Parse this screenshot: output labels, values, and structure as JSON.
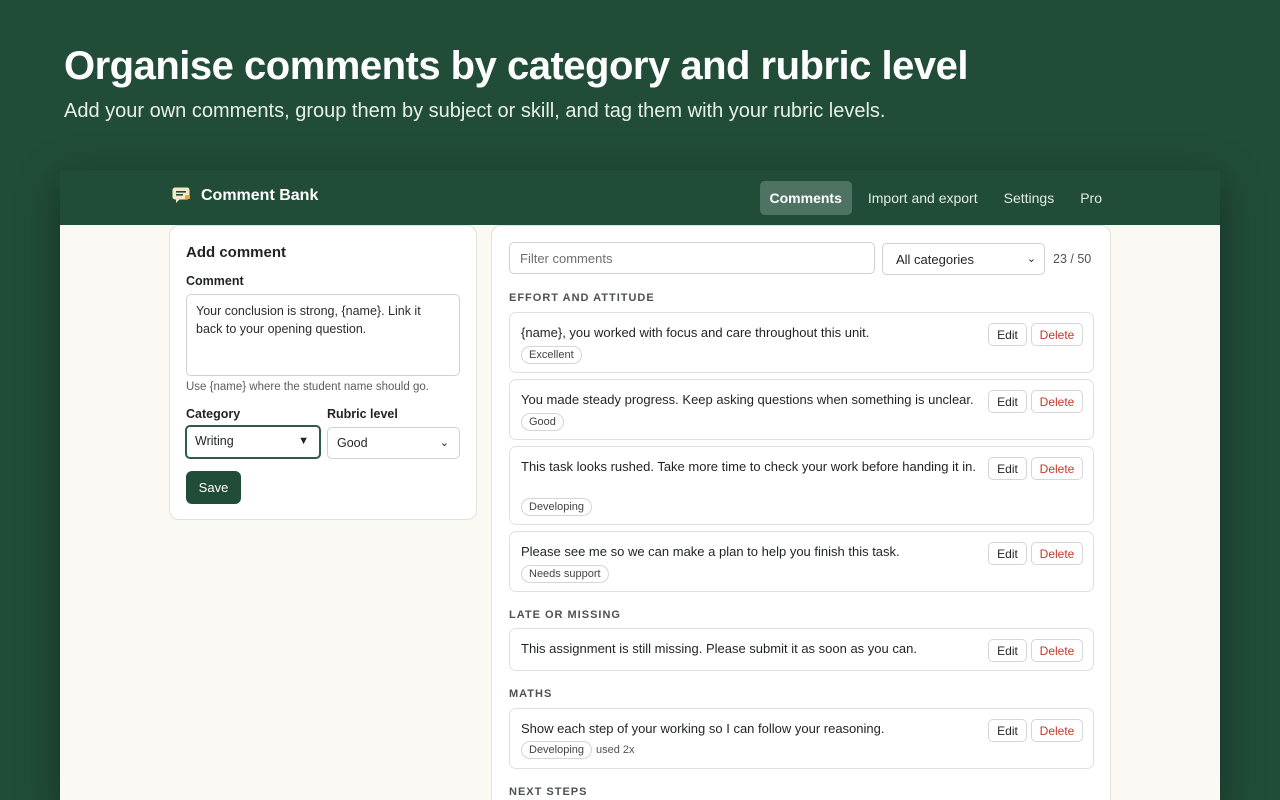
{
  "hero": {
    "title": "Organise comments by category and rubric level",
    "subtitle": "Add your own comments, group them by subject or skill, and tag them with your rubric levels."
  },
  "app": {
    "brand": "Comment Bank",
    "brand_icon": "speech-bubble-icon",
    "nav": [
      "Comments",
      "Import and export",
      "Settings",
      "Pro"
    ],
    "active_nav": "Comments"
  },
  "add_comment": {
    "title": "Add comment",
    "comment_label": "Comment",
    "comment_value": "Your conclusion is strong, {name}. Link it back to your opening question.",
    "hint": "Use {name} where the student name should go.",
    "category_label": "Category",
    "category_value": "Writing",
    "rubric_label": "Rubric level",
    "rubric_value": "Good",
    "save_label": "Save"
  },
  "list": {
    "filter_placeholder": "Filter comments",
    "category_filter": "All categories",
    "count": "23 / 50",
    "edit_label": "Edit",
    "delete_label": "Delete",
    "sections": [
      {
        "heading": "EFFORT AND ATTITUDE",
        "items": [
          {
            "text": "{name}, you worked with focus and care throughout this unit.",
            "tag": "Excellent"
          },
          {
            "text": "You made steady progress. Keep asking questions when something is unclear.",
            "tag": "Good"
          },
          {
            "text": "This task looks rushed. Take more time to check your work before handing it in.",
            "tag": "Developing"
          },
          {
            "text": "Please see me so we can make a plan to help you finish this task.",
            "tag": "Needs support"
          }
        ]
      },
      {
        "heading": "LATE OR MISSING",
        "items": [
          {
            "text": "This assignment is still missing. Please submit it as soon as you can."
          }
        ]
      },
      {
        "heading": "MATHS",
        "items": [
          {
            "text": "Show each step of your working so I can follow your reasoning.",
            "tag": "Developing",
            "usage": "used 2x"
          }
        ]
      },
      {
        "heading": "NEXT STEPS",
        "items": []
      }
    ]
  },
  "colors": {
    "brand_green": "#214d38",
    "app_bg": "#faf9f3",
    "delete_red": "#c0392b"
  }
}
